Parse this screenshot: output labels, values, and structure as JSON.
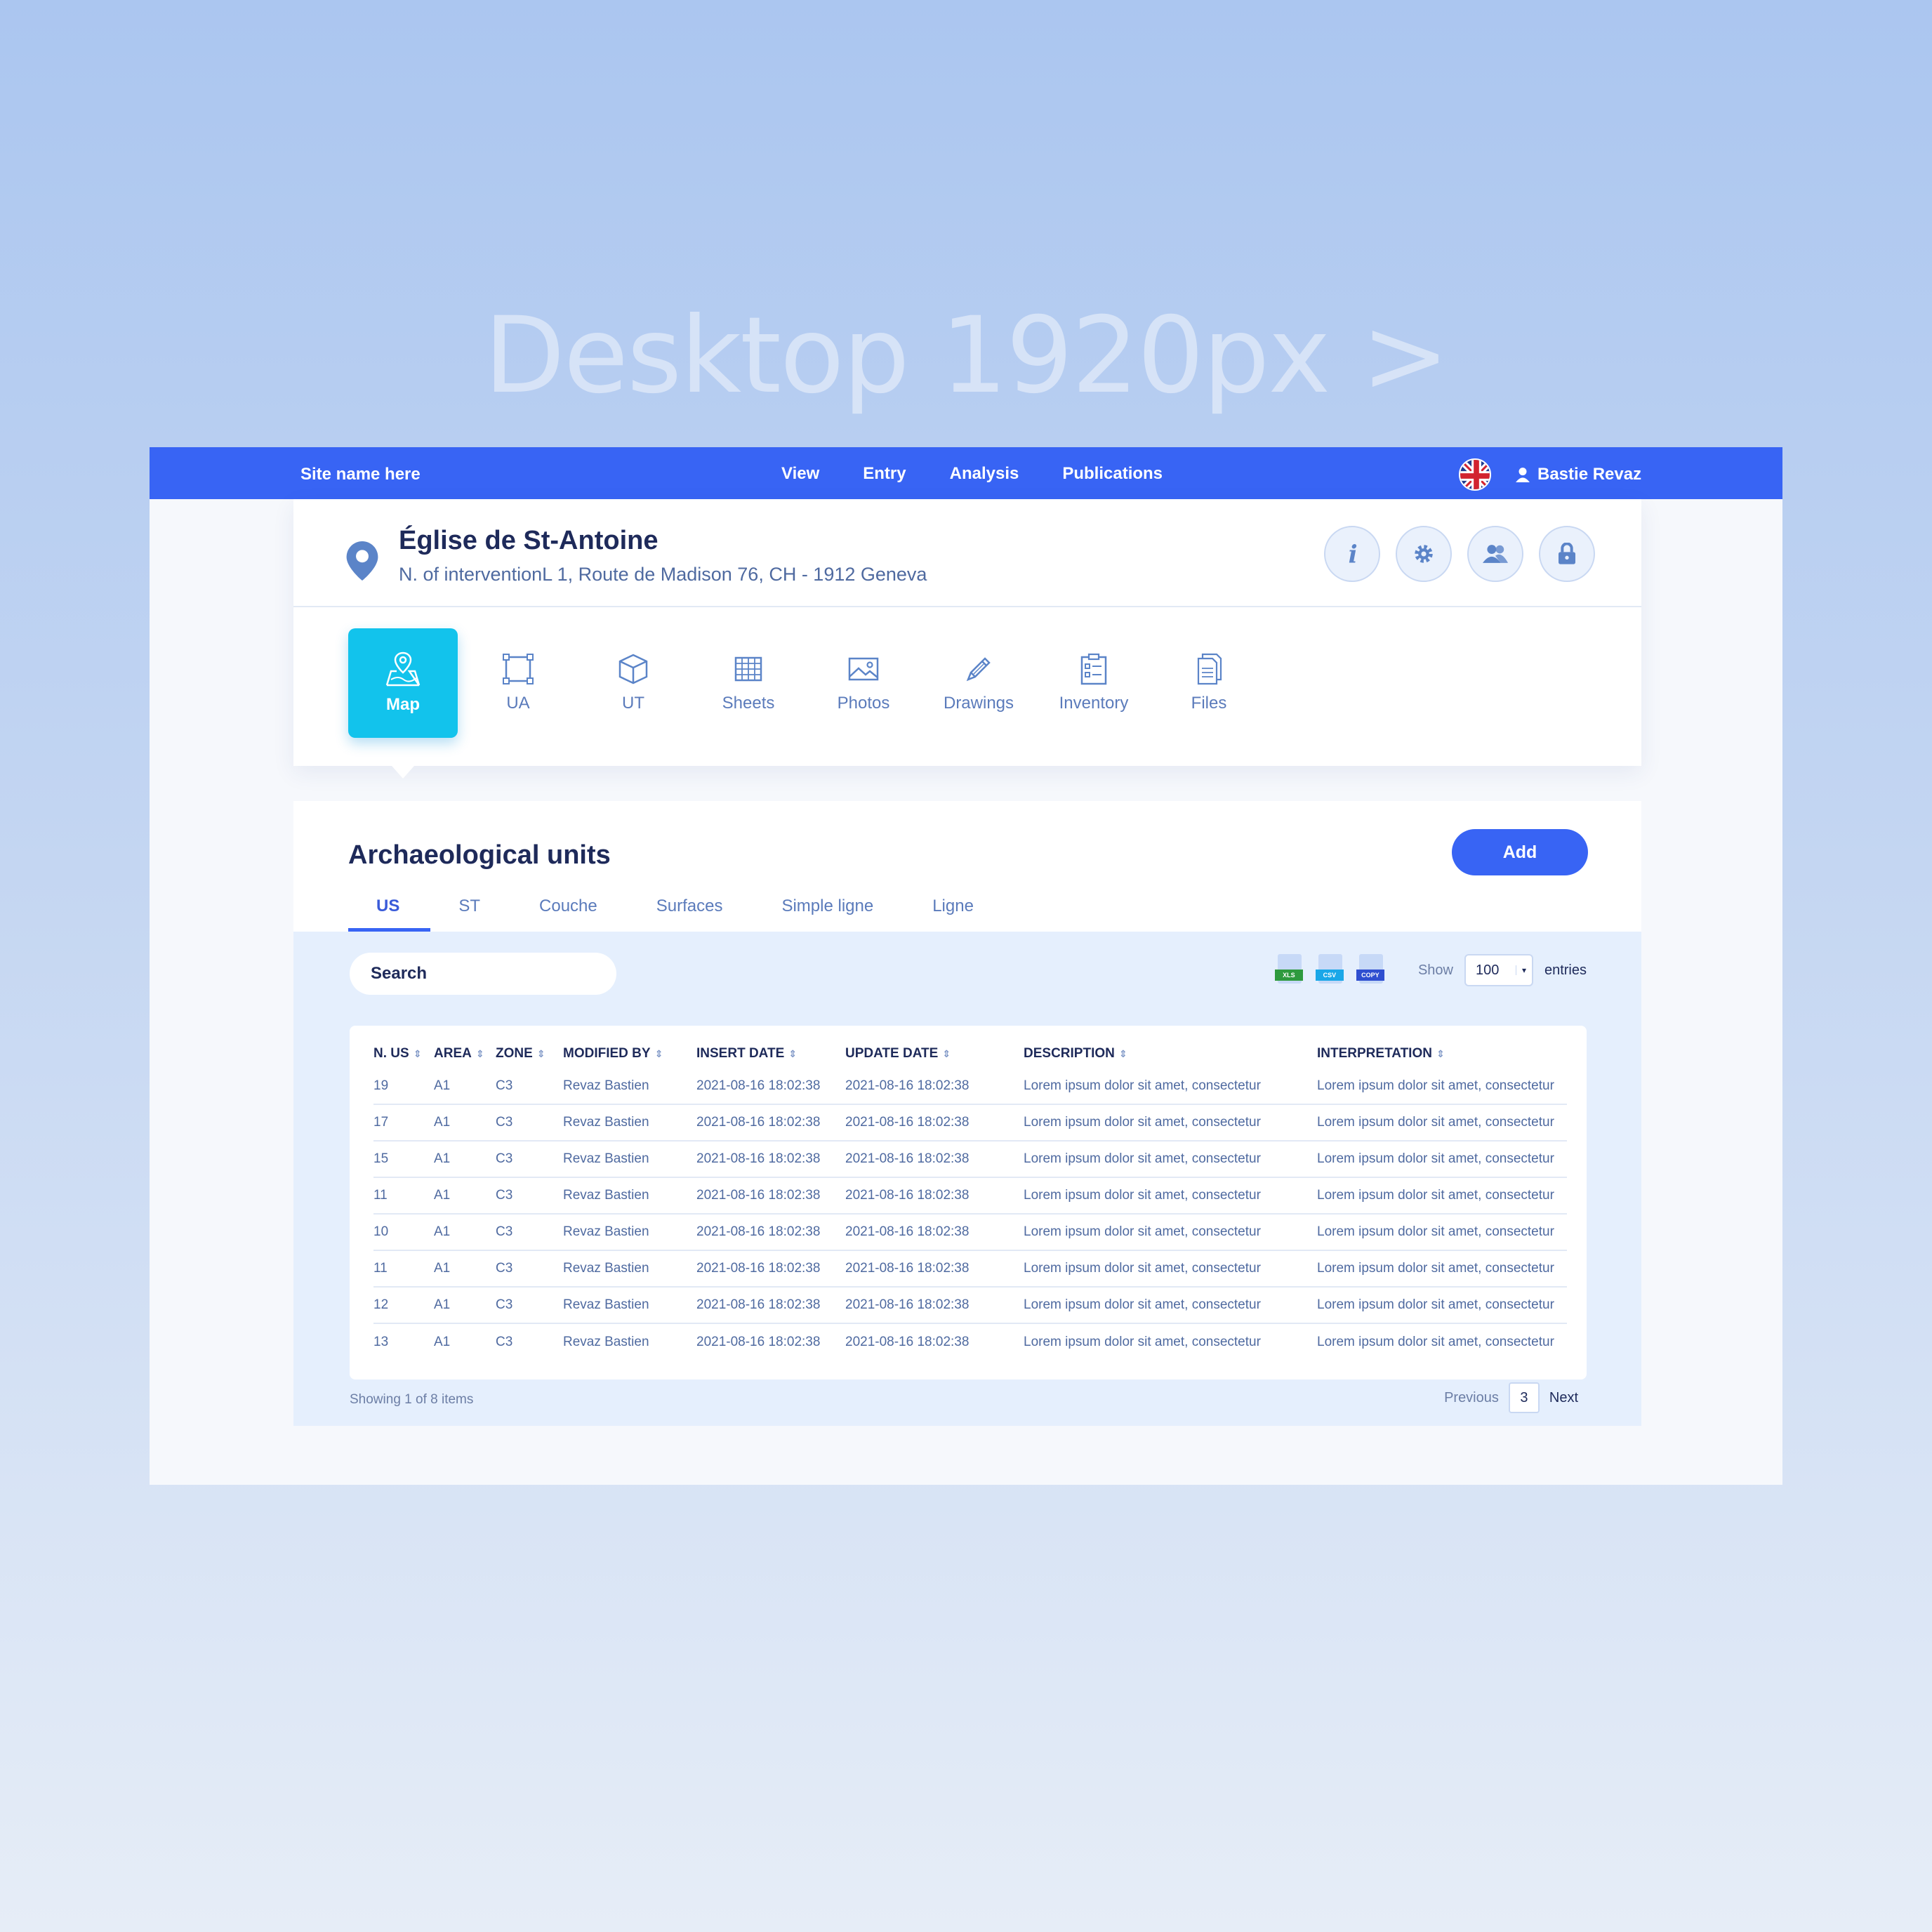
{
  "hero": {
    "title": "Desktop 1920px >"
  },
  "topbar": {
    "site_name": "Site name here",
    "nav": [
      "View",
      "Entry",
      "Analysis",
      "Publications"
    ],
    "user_name": "Bastie Revaz",
    "language_icon": "uk-flag-icon"
  },
  "site": {
    "title": "Église de St-Antoine",
    "address": "N. of interventionL 1, Route de Madison 76, CH - 1912 Geneva",
    "actions": [
      "info-icon",
      "gear-icon",
      "users-icon",
      "lock-icon"
    ]
  },
  "modules": [
    {
      "label": "Map",
      "icon": "map-pin-icon",
      "active": true
    },
    {
      "label": "UA",
      "icon": "square-icon",
      "active": false
    },
    {
      "label": "UT",
      "icon": "cube-icon",
      "active": false
    },
    {
      "label": "Sheets",
      "icon": "grid-icon",
      "active": false
    },
    {
      "label": "Photos",
      "icon": "image-icon",
      "active": false
    },
    {
      "label": "Drawings",
      "icon": "pencil-icon",
      "active": false
    },
    {
      "label": "Inventory",
      "icon": "checklist-icon",
      "active": false
    },
    {
      "label": "Files",
      "icon": "files-icon",
      "active": false
    }
  ],
  "units": {
    "title": "Archaeological units",
    "add_label": "Add",
    "tabs": [
      "US",
      "ST",
      "Couche",
      "Surfaces",
      "Simple ligne",
      "Ligne"
    ],
    "active_tab": 0,
    "search_placeholder": "Search",
    "export": [
      "XLS",
      "CSV",
      "COPY"
    ],
    "show_label": "Show",
    "page_size": "100",
    "entries_label": "entries",
    "columns": [
      "N. US",
      "AREA",
      "ZONE",
      "MODIFIED BY",
      "INSERT DATE",
      "UPDATE DATE",
      "DESCRIPTION",
      "INTERPRETATION"
    ],
    "rows": [
      [
        "19",
        "A1",
        "C3",
        "Revaz Bastien",
        "2021-08-16 18:02:38",
        "2021-08-16 18:02:38",
        "Lorem ipsum dolor sit amet, consectetur",
        "Lorem ipsum dolor sit amet, consectetur"
      ],
      [
        "17",
        "A1",
        "C3",
        "Revaz Bastien",
        "2021-08-16 18:02:38",
        "2021-08-16 18:02:38",
        "Lorem ipsum dolor sit amet, consectetur",
        "Lorem ipsum dolor sit amet, consectetur"
      ],
      [
        "15",
        "A1",
        "C3",
        "Revaz Bastien",
        "2021-08-16 18:02:38",
        "2021-08-16 18:02:38",
        "Lorem ipsum dolor sit amet, consectetur",
        "Lorem ipsum dolor sit amet, consectetur"
      ],
      [
        "11",
        "A1",
        "C3",
        "Revaz Bastien",
        "2021-08-16 18:02:38",
        "2021-08-16 18:02:38",
        "Lorem ipsum dolor sit amet, consectetur",
        "Lorem ipsum dolor sit amet, consectetur"
      ],
      [
        "10",
        "A1",
        "C3",
        "Revaz Bastien",
        "2021-08-16 18:02:38",
        "2021-08-16 18:02:38",
        "Lorem ipsum dolor sit amet, consectetur",
        "Lorem ipsum dolor sit amet, consectetur"
      ],
      [
        "11",
        "A1",
        "C3",
        "Revaz Bastien",
        "2021-08-16 18:02:38",
        "2021-08-16 18:02:38",
        "Lorem ipsum dolor sit amet, consectetur",
        "Lorem ipsum dolor sit amet, consectetur"
      ],
      [
        "12",
        "A1",
        "C3",
        "Revaz Bastien",
        "2021-08-16 18:02:38",
        "2021-08-16 18:02:38",
        "Lorem ipsum dolor sit amet, consectetur",
        "Lorem ipsum dolor sit amet, consectetur"
      ],
      [
        "13",
        "A1",
        "C3",
        "Revaz Bastien",
        "2021-08-16 18:02:38",
        "2021-08-16 18:02:38",
        "Lorem ipsum dolor sit amet, consectetur",
        "Lorem ipsum dolor sit amet, consectetur"
      ]
    ],
    "showing": "Showing 1 of 8 items",
    "previous_label": "Previous",
    "current_page": "3",
    "next_label": "Next"
  },
  "colors": {
    "primary": "#3864f4",
    "accent": "#12c3ec",
    "text_dark": "#1e2a5a",
    "text_muted": "#4f6aa0"
  }
}
